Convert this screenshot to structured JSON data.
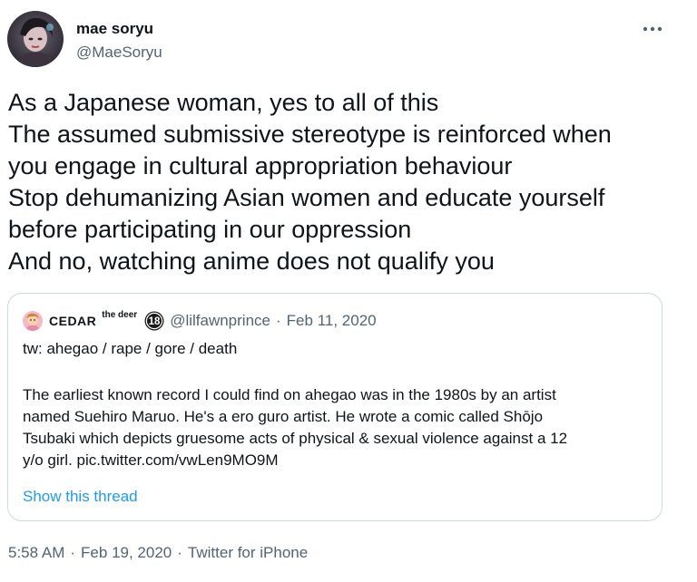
{
  "author": {
    "display_name": "mae soryu",
    "handle": "@MaeSoryu"
  },
  "tweet": {
    "lines": [
      "As a Japanese woman, yes to all of this",
      "The assumed submissive stereotype is reinforced when",
      "you engage in cultural appropriation behaviour",
      "Stop dehumanizing Asian women and educate yourself",
      "before participating in our oppression",
      "And no, watching anime does not qualify you"
    ]
  },
  "quoted": {
    "display_name": "CEDAR",
    "display_name_sup": "the deer",
    "badge": "18",
    "handle": "@lilfawnprince",
    "separator": "·",
    "date": "Feb 11, 2020",
    "tw_line": "tw: ahegao / rape / gore / death",
    "body_lines": [
      "The earliest known record I could find on ahegao was in the 1980s by an artist",
      "named Suehiro Maruo. He's a ero guro artist. He wrote a comic called Shōjo",
      "Tsubaki which depicts gruesome acts of physical & sexual violence against a 12",
      "y/o girl. pic.twitter.com/vwLen9MO9M"
    ],
    "show_thread": "Show this thread"
  },
  "meta": {
    "time": "5:58 AM",
    "separator": "·",
    "date": "Feb 19, 2020",
    "source": "Twitter for iPhone"
  },
  "icons": {
    "more": "more-horizontal-icon",
    "badge": "circled-18-badge-icon"
  },
  "colors": {
    "text": "#0f1419",
    "secondary": "#536471",
    "link": "#1d9bf0",
    "border": "#cfd9de"
  }
}
